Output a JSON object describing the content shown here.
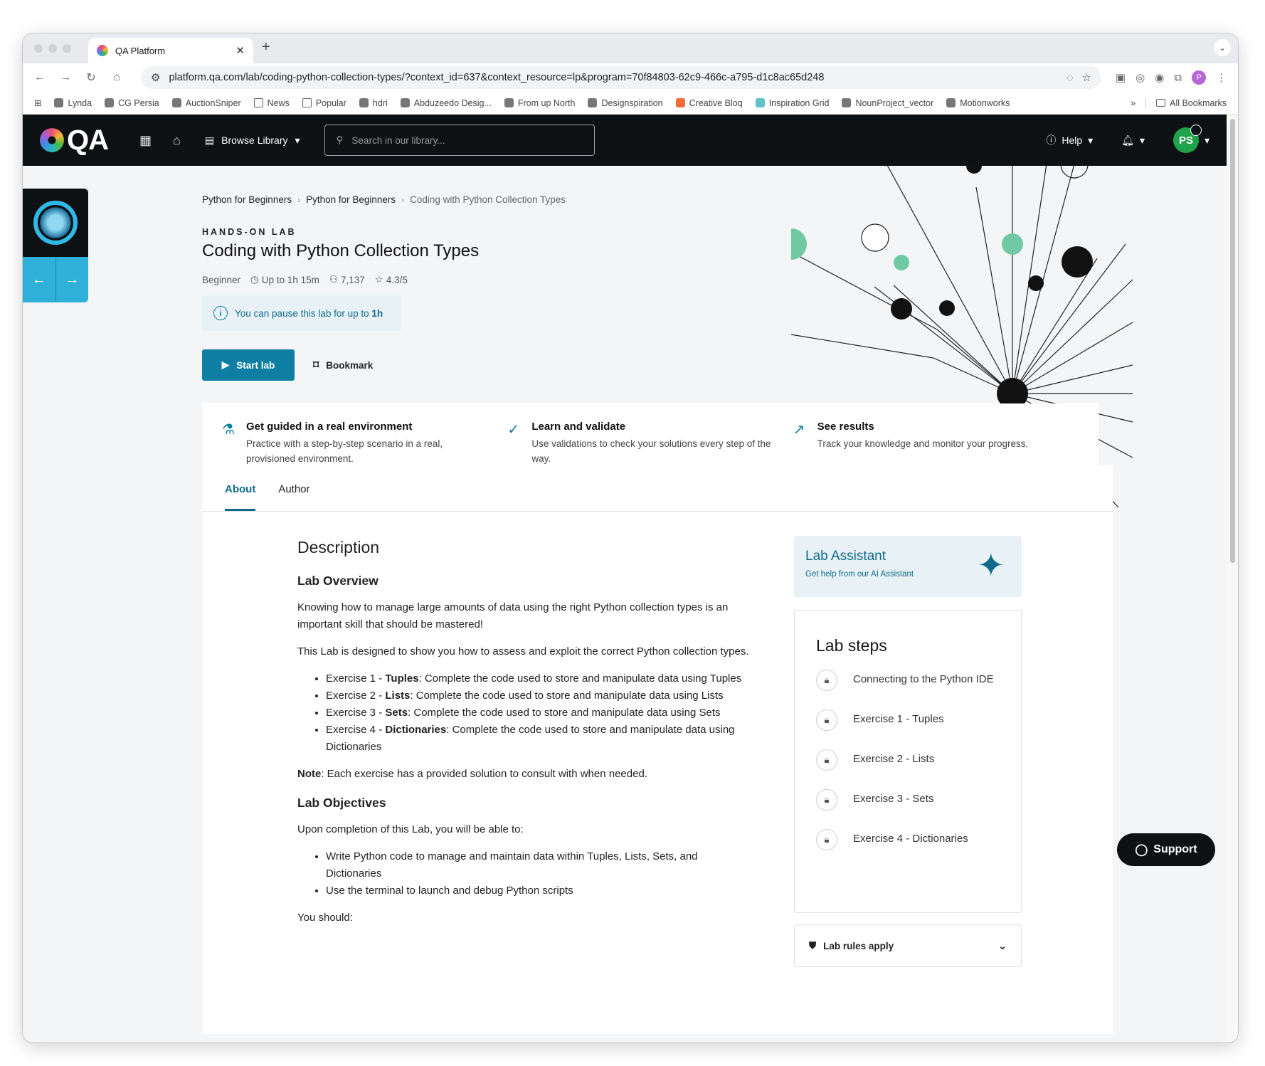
{
  "browser": {
    "tab_title": "QA Platform",
    "url": "platform.qa.com/lab/coding-python-collection-types/?context_id=637&context_resource=lp&program=70f84803-62c9-466c-a795-d1c8ac65d248",
    "bookmarks": [
      "Lynda",
      "CG Persia",
      "AuctionSniper",
      "News",
      "Popular",
      "hdri",
      "Abduzeedo Desig...",
      "From up North",
      "Designspiration",
      "Creative Bloq",
      "Inspiration Grid",
      "NounProject_vector",
      "Motionworks"
    ],
    "all_bookmarks": "All Bookmarks",
    "profile_initial": "P"
  },
  "header": {
    "logo": "QA",
    "browse": "Browse Library",
    "search_placeholder": "Search in our library...",
    "help": "Help",
    "avatar": "PS"
  },
  "breadcrumb": [
    "Python for Beginners",
    "Python for Beginners",
    "Coding with Python Collection Types"
  ],
  "lab": {
    "kicker": "HANDS-ON LAB",
    "title": "Coding with Python Collection Types",
    "level": "Beginner",
    "duration": "Up to 1h 15m",
    "learners": "7,137",
    "rating": "4.3/5",
    "pause_text": "You can pause this lab for up to ",
    "pause_value": "1h",
    "start_label": "Start lab",
    "bookmark_label": "Bookmark"
  },
  "features": [
    {
      "title": "Get guided in a real environment",
      "text": "Practice with a step-by-step scenario in a real, provisioned environment.",
      "icon": "flask-icon"
    },
    {
      "title": "Learn and validate",
      "text": "Use validations to check your solutions every step of the way.",
      "icon": "check-circle-icon"
    },
    {
      "title": "See results",
      "text": "Track your knowledge and monitor your progress.",
      "icon": "chart-icon"
    }
  ],
  "tabs": [
    "About",
    "Author"
  ],
  "description": {
    "heading": "Description",
    "overview_heading": "Lab Overview",
    "p1": "Knowing how to manage large amounts of data using the right Python collection types is an important skill that should be mastered!",
    "p2": "This Lab is designed to show you how to assess and exploit the correct Python collection types.",
    "exercises": [
      {
        "pre": "Exercise 1 - ",
        "bold": "Tuples",
        "post": ": Complete the code used to store and manipulate data using Tuples"
      },
      {
        "pre": "Exercise 2 - ",
        "bold": "Lists",
        "post": ": Complete the code used to store and manipulate data using Lists"
      },
      {
        "pre": "Exercise 3 - ",
        "bold": "Sets",
        "post": ": Complete the code used to store and manipulate data using Sets"
      },
      {
        "pre": "Exercise 4 - ",
        "bold": "Dictionaries",
        "post": ": Complete the code used to store and manipulate data using Dictionaries"
      }
    ],
    "note_label": "Note",
    "note_text": ": Each exercise has a provided solution to consult with when needed.",
    "objectives_heading": "Lab Objectives",
    "objectives_intro": "Upon completion of this Lab, you will be able to:",
    "objectives": [
      "Write Python code to manage and maintain data within Tuples, Lists, Sets, and Dictionaries",
      "Use the terminal to launch and debug Python scripts"
    ],
    "you_should": "You should:"
  },
  "assistant": {
    "title": "Lab Assistant",
    "subtitle": "Get help from our AI Assistant"
  },
  "steps": {
    "heading": "Lab steps",
    "items": [
      "Connecting to the Python IDE",
      "Exercise 1 - Tuples",
      "Exercise 2 - Lists",
      "Exercise 3 - Sets",
      "Exercise 4 - Dictionaries"
    ]
  },
  "rules_label": "Lab rules apply",
  "support_label": "Support"
}
